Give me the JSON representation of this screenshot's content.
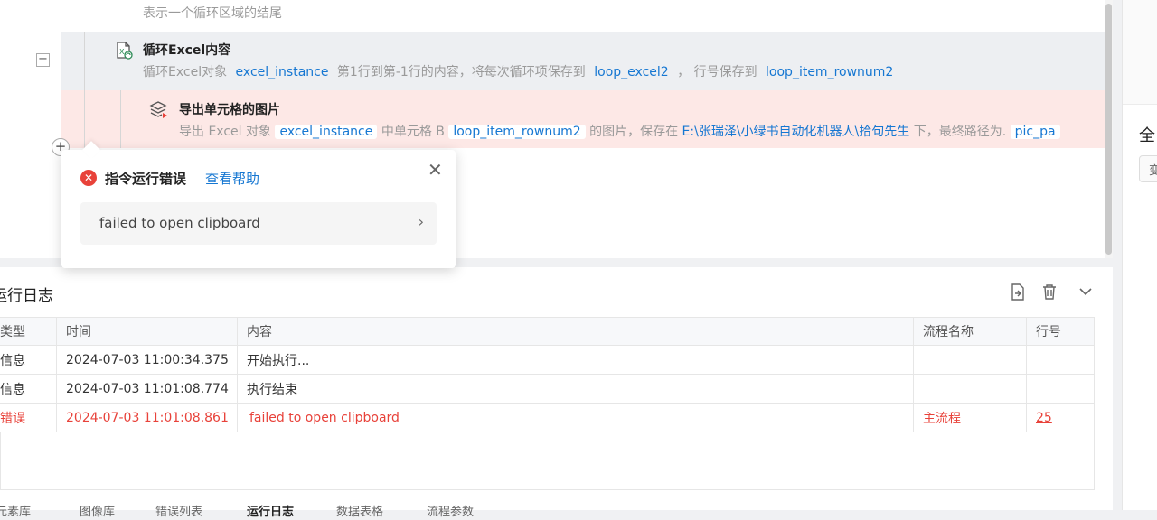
{
  "flow": {
    "end_row": {
      "desc": "表示一个循环区域的结尾"
    },
    "loop_row": {
      "title": "循环Excel内容",
      "desc_1": "循环Excel对象",
      "var_instance": "excel_instance",
      "desc_2": "第1行到第-1行的内容，将每次循环项保存到",
      "var_item": "loop_excel2",
      "desc_3": "，  行号保存到",
      "var_rownum": "loop_item_rownum2"
    },
    "export_row": {
      "title": "导出单元格的图片",
      "desc_1": "导出 Excel 对象",
      "var_instance": "excel_instance",
      "desc_2": "中单元格 B",
      "var_rownum": "loop_item_rownum2",
      "desc_3": "的图片，保存在",
      "path": "E:\\张瑞泽\\小绿书自动化机器人\\拾句先生",
      "desc_4": "下，最终路径为.",
      "var_pic": "pic_pa"
    },
    "collapse_symbol": "−",
    "add_symbol": "+"
  },
  "popup": {
    "title": "指令运行错误",
    "help_link": "查看帮助",
    "close_symbol": "✕",
    "message": "failed to open clipboard",
    "expand_symbol": "›"
  },
  "log": {
    "title": "运行日志",
    "columns": [
      "类型",
      "时间",
      "内容",
      "流程名称",
      "行号"
    ],
    "rows": [
      {
        "type": "信息",
        "time": "2024-07-03 11:00:34.375",
        "content": "开始执行...",
        "flow": "",
        "line": ""
      },
      {
        "type": "信息",
        "time": "2024-07-03 11:01:08.774",
        "content": "执行结束",
        "flow": "",
        "line": ""
      },
      {
        "type": "错误",
        "time": "2024-07-03 11:01:08.861",
        "content": "failed to open clipboard",
        "flow": "主流程",
        "line": "25"
      }
    ],
    "tabs": [
      "元素库",
      "图像库",
      "错误列表",
      "运行日志",
      "数据表格",
      "流程参数"
    ],
    "active_tab": "运行日志"
  },
  "right_panel": {
    "title": "全",
    "box_label": "变"
  },
  "colors": {
    "accent": "#1677d2",
    "error": "#e8423a",
    "error_row_bg": "#fde8e6",
    "selected_row_bg": "#edeff2"
  }
}
